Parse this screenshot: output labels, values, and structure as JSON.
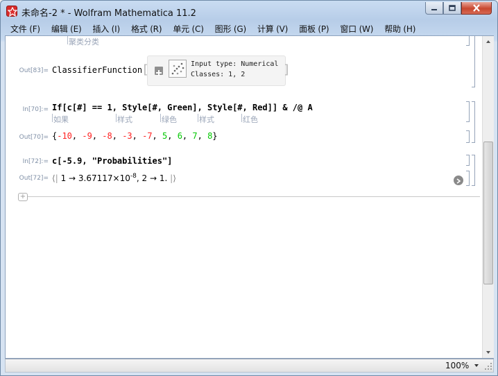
{
  "window": {
    "title": "未命名-2 * - Wolfram Mathematica 11.2"
  },
  "menu": {
    "items": [
      {
        "label": "文件 (F)"
      },
      {
        "label": "编辑 (E)"
      },
      {
        "label": "插入 (I)"
      },
      {
        "label": "格式 (R)"
      },
      {
        "label": "单元 (C)"
      },
      {
        "label": "图形 (G)"
      },
      {
        "label": "计算 (V)"
      },
      {
        "label": "面板 (P)"
      },
      {
        "label": "窗口 (W)"
      },
      {
        "label": "帮助 (H)"
      }
    ]
  },
  "notebook": {
    "top_hint": "聚类分类",
    "cells": {
      "out83": {
        "label": "Out[83]=",
        "head": "ClassifierFunction",
        "input_type": "Input type: Numerical",
        "classes": "Classes: 1, 2"
      },
      "in70": {
        "label": "In[70]:=",
        "code": "If[c[#] == 1, Style[#, Green], Style[#, Red]] & /@ A",
        "hints": [
          "如果",
          "样式",
          "绿色",
          "样式",
          "红色"
        ]
      },
      "out70": {
        "label": "Out[70]=",
        "open": "{",
        "close": "}",
        "red_values": [
          "-10",
          "-9",
          "-8",
          "-3",
          "-7"
        ],
        "green_values": [
          "5",
          "6",
          "7",
          "8"
        ]
      },
      "in72": {
        "label": "In[72]:=",
        "code": "c[-5.9, \"Probabilities\"]"
      },
      "out72": {
        "label": "Out[72]=",
        "assoc_open": "⟨",
        "assoc_close": "⟩",
        "part1_key": "1",
        "arrow": "→",
        "part1_mantissa": "3.67117",
        "times": "×",
        "part1_base": "10",
        "part1_exp": "-8",
        "sep": ",",
        "part2_key": "2",
        "part2_value": "1."
      }
    }
  },
  "status": {
    "zoom": "100%"
  },
  "colors": {
    "red": "#ff2020",
    "green": "#00c800",
    "label": "#7f8fa6"
  }
}
